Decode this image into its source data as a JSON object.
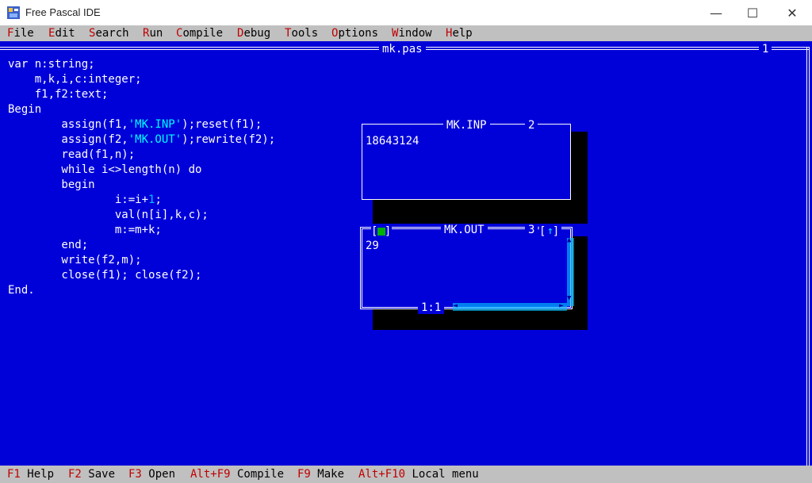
{
  "window": {
    "title": "Free Pascal IDE",
    "minimize": "—",
    "maximize": "☐",
    "close": "✕"
  },
  "menu": [
    {
      "hot": "F",
      "rest": "ile"
    },
    {
      "hot": "E",
      "rest": "dit"
    },
    {
      "hot": "S",
      "rest": "earch"
    },
    {
      "hot": "R",
      "rest": "un"
    },
    {
      "hot": "C",
      "rest": "ompile"
    },
    {
      "hot": "D",
      "rest": "ebug"
    },
    {
      "hot": "T",
      "rest": "ools"
    },
    {
      "hot": "O",
      "rest": "ptions"
    },
    {
      "hot": "W",
      "rest": "indow"
    },
    {
      "hot": "H",
      "rest": "elp"
    }
  ],
  "editor": {
    "title": "mk.pas",
    "number": "1",
    "lines": [
      {
        "a": "var n:string;"
      },
      {
        "a": "    m,k,i,c:integer;"
      },
      {
        "a": "    f1,f2:text;"
      },
      {
        "a": "Begin"
      },
      {
        "a": "        assign(f1,",
        "s": "'MK.INP'",
        "b": ");reset(f1);"
      },
      {
        "a": "        assign(f2,",
        "s": "'MK.OUT'",
        "b": ");rewrite(f2);"
      },
      {
        "a": "        read(f1,n);"
      },
      {
        "a": "        while i<>length(n) do"
      },
      {
        "a": "        begin"
      },
      {
        "a": "                i:=i+",
        "n": "1",
        "b": ";"
      },
      {
        "a": "                val(n[i],k,c);"
      },
      {
        "a": "                m:=m+k;"
      },
      {
        "a": "        end;"
      },
      {
        "a": "        write(f2,m);"
      },
      {
        "a": "        close(f1); close(f2);"
      },
      {
        "a": "End."
      }
    ]
  },
  "inp_window": {
    "title": "MK.INP",
    "number": "2",
    "content": "18643124"
  },
  "out_window": {
    "title": "MK.OUT",
    "number": "3",
    "content": "29",
    "close_box": "■",
    "zoom_box": "↑",
    "position": "1:1",
    "scroll_left": "◄",
    "scroll_right": "►",
    "scroll_up": "▲",
    "scroll_down": "▼"
  },
  "status": [
    {
      "key": "F1",
      "label": " Help"
    },
    {
      "key": "F2",
      "label": " Save"
    },
    {
      "key": "F3",
      "label": " Open"
    },
    {
      "key": "Alt+F9",
      "label": " Compile"
    },
    {
      "key": "F9",
      "label": " Make"
    },
    {
      "key": "Alt+F10",
      "label": " Local menu"
    }
  ],
  "colors": {
    "desktop": "#0000d8",
    "bars": "#c0c0c0",
    "hotkey": "#c00000",
    "string": "#00ffff",
    "green_box": "#00b000"
  }
}
